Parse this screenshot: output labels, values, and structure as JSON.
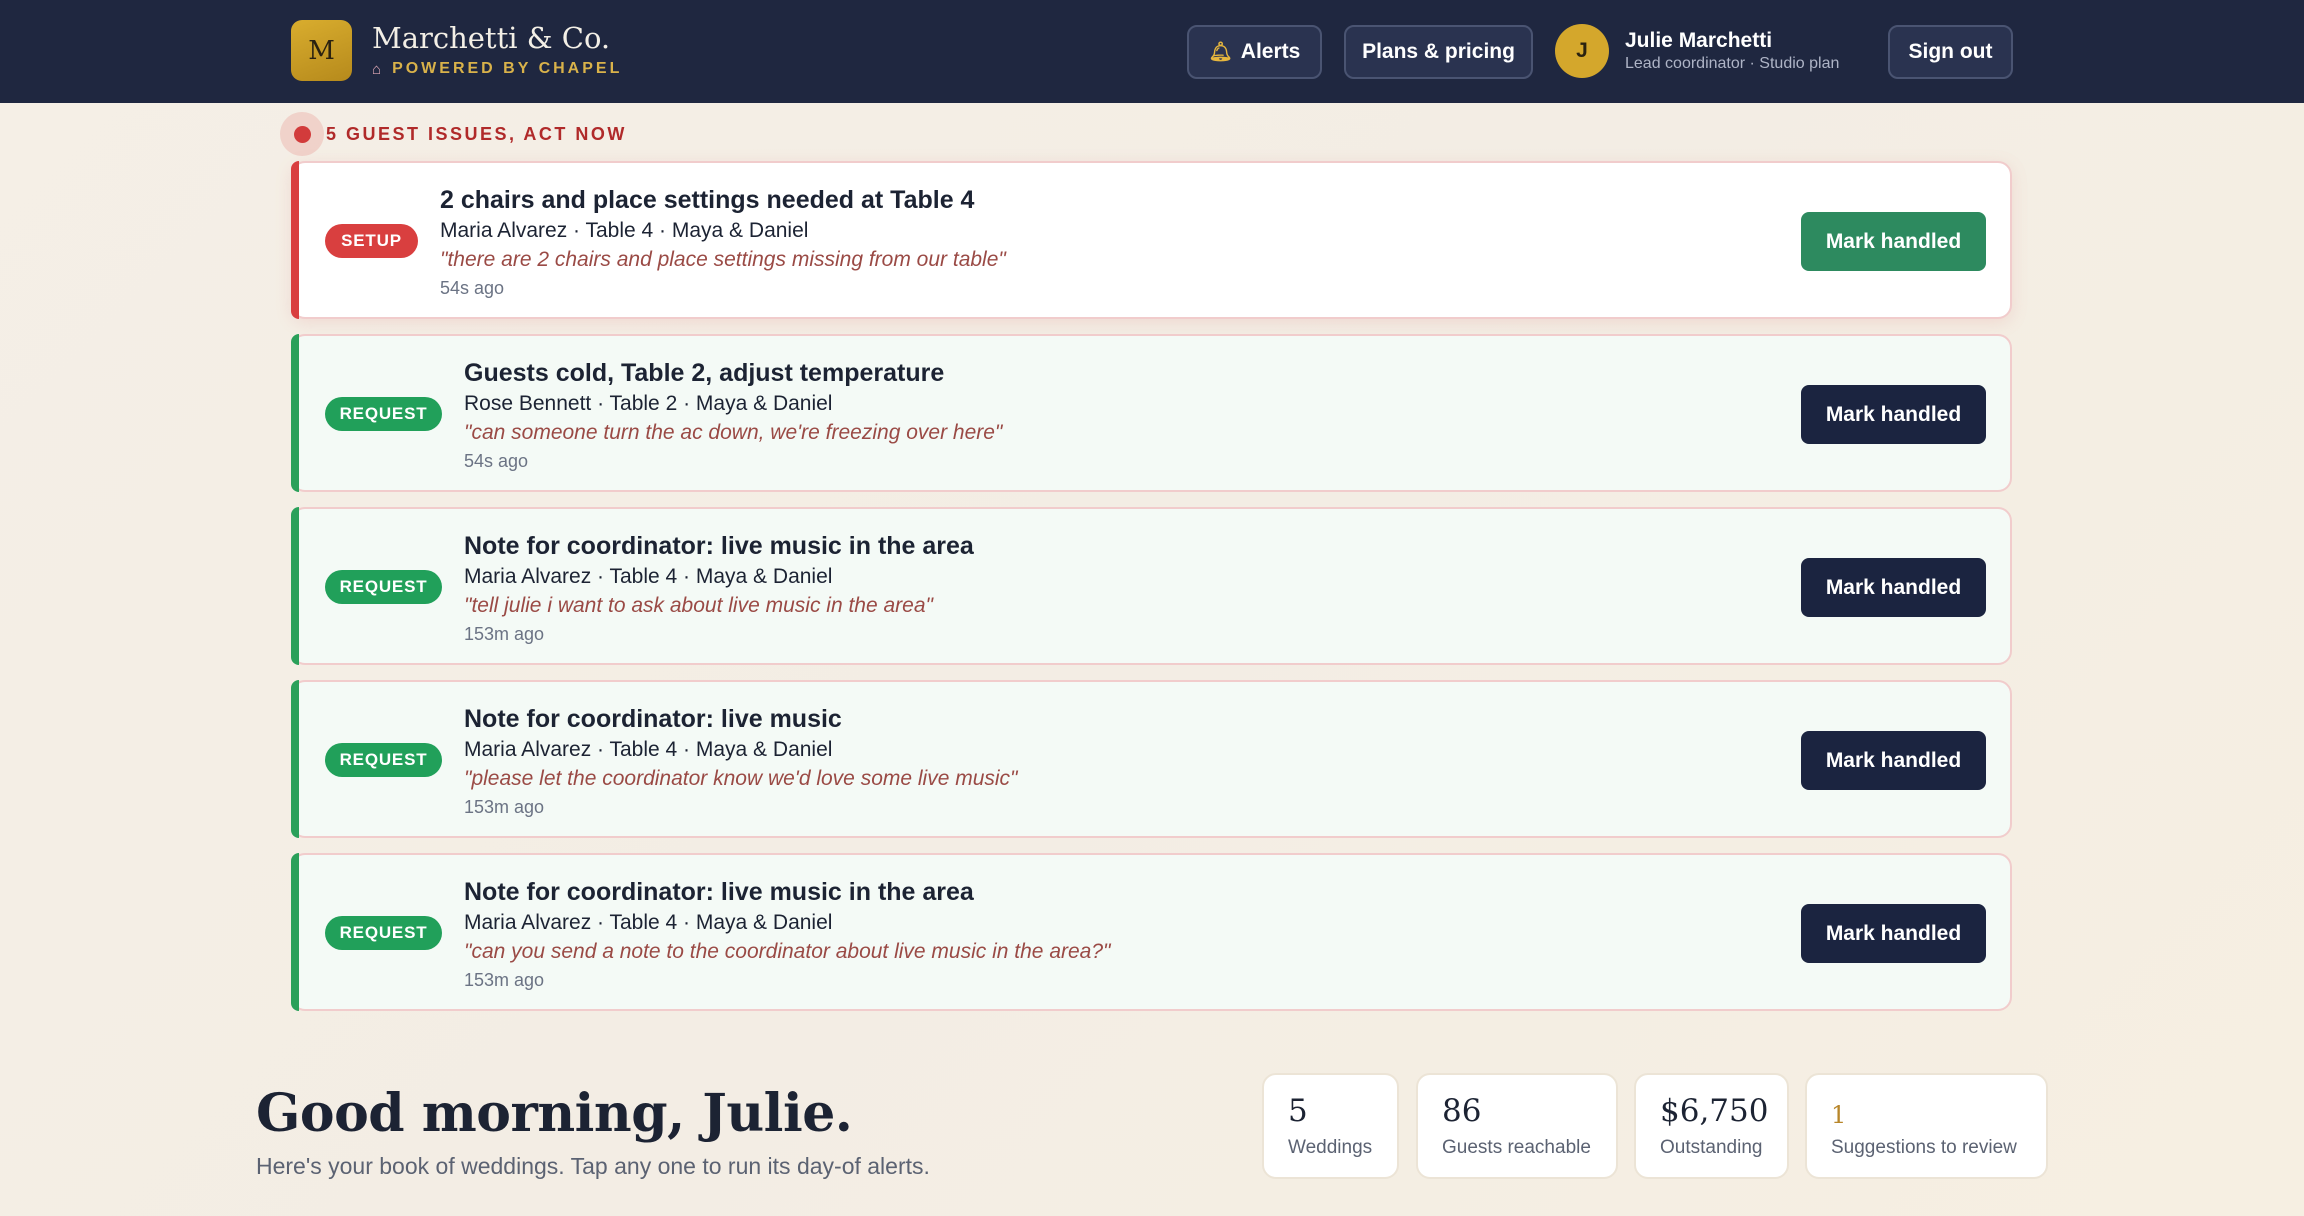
{
  "header": {
    "logo_letter": "M",
    "brand_name": "Marchetti & Co.",
    "brand_sub": "POWERED BY CHAPEL",
    "brand_sub_icon": "chapel-icon",
    "alerts_label": "Alerts",
    "alerts_icon": "bell-icon",
    "plans_label": "Plans & pricing",
    "user_initial": "J",
    "user_name": "Julie Marchetti",
    "user_role": "Lead coordinator · Studio plan",
    "signout_label": "Sign out"
  },
  "issues": {
    "heading": "5 GUEST ISSUES, ACT NOW",
    "items": [
      {
        "badge": "SETUP",
        "title": "2 chairs and place settings needed at Table 4",
        "meta": "Maria Alvarez · Table 4 · Maya & Daniel",
        "quote": "\"there are 2 chairs and place settings missing from our table\"",
        "time": "54s ago",
        "action": "Mark handled"
      },
      {
        "badge": "REQUEST",
        "title": "Guests cold, Table 2, adjust temperature",
        "meta": "Rose Bennett · Table 2 · Maya & Daniel",
        "quote": "\"can someone turn the ac down, we're freezing over here\"",
        "time": "54s ago",
        "action": "Mark handled"
      },
      {
        "badge": "REQUEST",
        "title": "Note for coordinator: live music in the area",
        "meta": "Maria Alvarez · Table 4 · Maya & Daniel",
        "quote": "\"tell julie i want to ask about live music in the area\"",
        "time": "153m ago",
        "action": "Mark handled"
      },
      {
        "badge": "REQUEST",
        "title": "Note for coordinator: live music",
        "meta": "Maria Alvarez · Table 4 · Maya & Daniel",
        "quote": "\"please let the coordinator know we'd love some live music\"",
        "time": "153m ago",
        "action": "Mark handled"
      },
      {
        "badge": "REQUEST",
        "title": "Note for coordinator: live music in the area",
        "meta": "Maria Alvarez · Table 4 · Maya & Daniel",
        "quote": "\"can you send a note to the coordinator about live music in the area?\"",
        "time": "153m ago",
        "action": "Mark handled"
      }
    ]
  },
  "greeting": {
    "title": "Good morning, Julie.",
    "subtitle": "Here's your book of weddings. Tap any one to run its day-of alerts."
  },
  "stats": [
    {
      "value": "5",
      "label": "Weddings"
    },
    {
      "value": "86",
      "label": "Guests reachable"
    },
    {
      "value": "$6,750",
      "label": "Outstanding"
    },
    {
      "value": "1",
      "label": "Suggestions to review"
    }
  ],
  "colors": {
    "navy": "#1f2740",
    "gold": "#d4a72c",
    "setup_red": "#d93f3f",
    "request_green": "#21a05a",
    "handled_green": "#2d8a5f",
    "handled_dark": "#1b2440"
  }
}
